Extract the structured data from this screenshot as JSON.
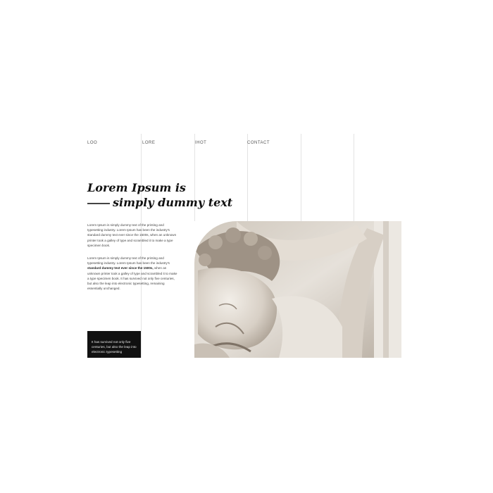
{
  "nav": {
    "items": [
      "Loo",
      "Lore",
      "Ihot",
      "Contact"
    ]
  },
  "headline": {
    "line1": "Lorem Ipsum is",
    "line2": "simply dummy text"
  },
  "paragraph1": "Lorem Ipsum is simply dummy text of the printing and typesetting industry. Lorem Ipsum has been the industry's standard dummy text ever since the 1500s, when an unknown printer took a galley of type and scrambled it to make a type specimen book.",
  "paragraph2": {
    "lead": "Lorem Ipsum is simply dummy text of the printing and typesetting industry. Lorem Ipsum has been the industry's",
    "bold": "standard dummy text ever since the 1500s,",
    "rest": "when an unknown printer took a galley of type and scrambled it to make a type specimen book. It has survived not only five centuries, but also the leap into electronic typesetting, remaining essentially unchanged."
  },
  "cta": {
    "text": "It has survived not only five centuries, but also the leap into electronic typesetting"
  },
  "hero": {
    "image": "marble-statue-photo"
  },
  "colors": {
    "background": "#ffffff",
    "text": "#111111",
    "cta_bg": "#111111",
    "grid_line": "#e3e3e3"
  }
}
